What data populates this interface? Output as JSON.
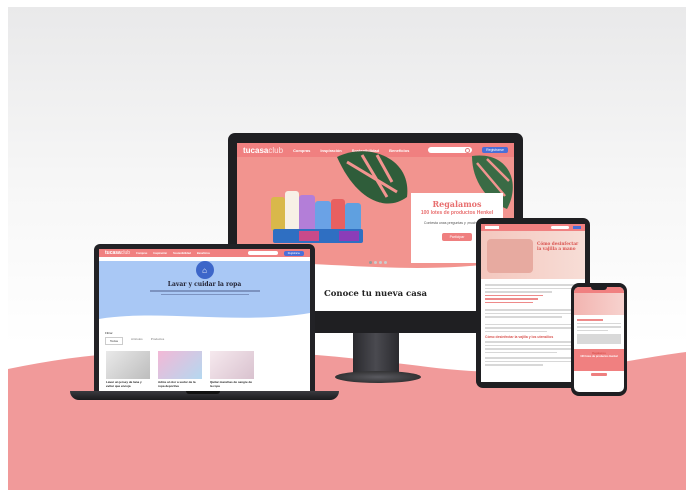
{
  "colors": {
    "accent": "#f08080",
    "accent_dark": "#d9534f",
    "brand_blue": "#4a6fd8",
    "hero_pink": "#f2948f",
    "lap_hero_blue": "#a9c8f5"
  },
  "monitor": {
    "brand": {
      "main": "tucasa",
      "sub": "club"
    },
    "nav": [
      "Compras",
      "Inspiración",
      "Sostenibilidad",
      "Beneficios"
    ],
    "search_placeholder": "",
    "account_button": "Registrarse",
    "promo": {
      "title": "Regalamos",
      "subtitle": "100 lotes de productos Henkel",
      "text": "Contesta unas preguntas y ¡mucha suerte!",
      "button": "Participar"
    },
    "section_title": "Conoce tu nueva casa"
  },
  "laptop": {
    "brand": {
      "main": "tucasa",
      "sub": "club"
    },
    "nav": [
      "Compras",
      "Inspiración",
      "Sostenibilidad",
      "Beneficios"
    ],
    "account_button": "Registrarse",
    "hero": {
      "title": "Lavar y cuidar la ropa",
      "icon": "laundry-icon"
    },
    "tabs_label": "Filtrar",
    "tabs": [
      "Todos",
      "Artículos",
      "Productos"
    ],
    "cards": [
      {
        "caption": "Lavar un jersey de lana y evitar que encoja"
      },
      {
        "caption": "Adiós al olor a sudor de la ropa deportiva"
      },
      {
        "caption": "Quitar manchas de sangre de la ropa"
      }
    ]
  },
  "tablet": {
    "hero_title": "Cómo desinfectar la vajilla a mano",
    "section_heading": "Cómo desinfectar la vajilla y los utensilios"
  },
  "phone": {
    "promo_title": "Regalamos",
    "promo_subtitle": "100 lotes de productos Henkel"
  }
}
